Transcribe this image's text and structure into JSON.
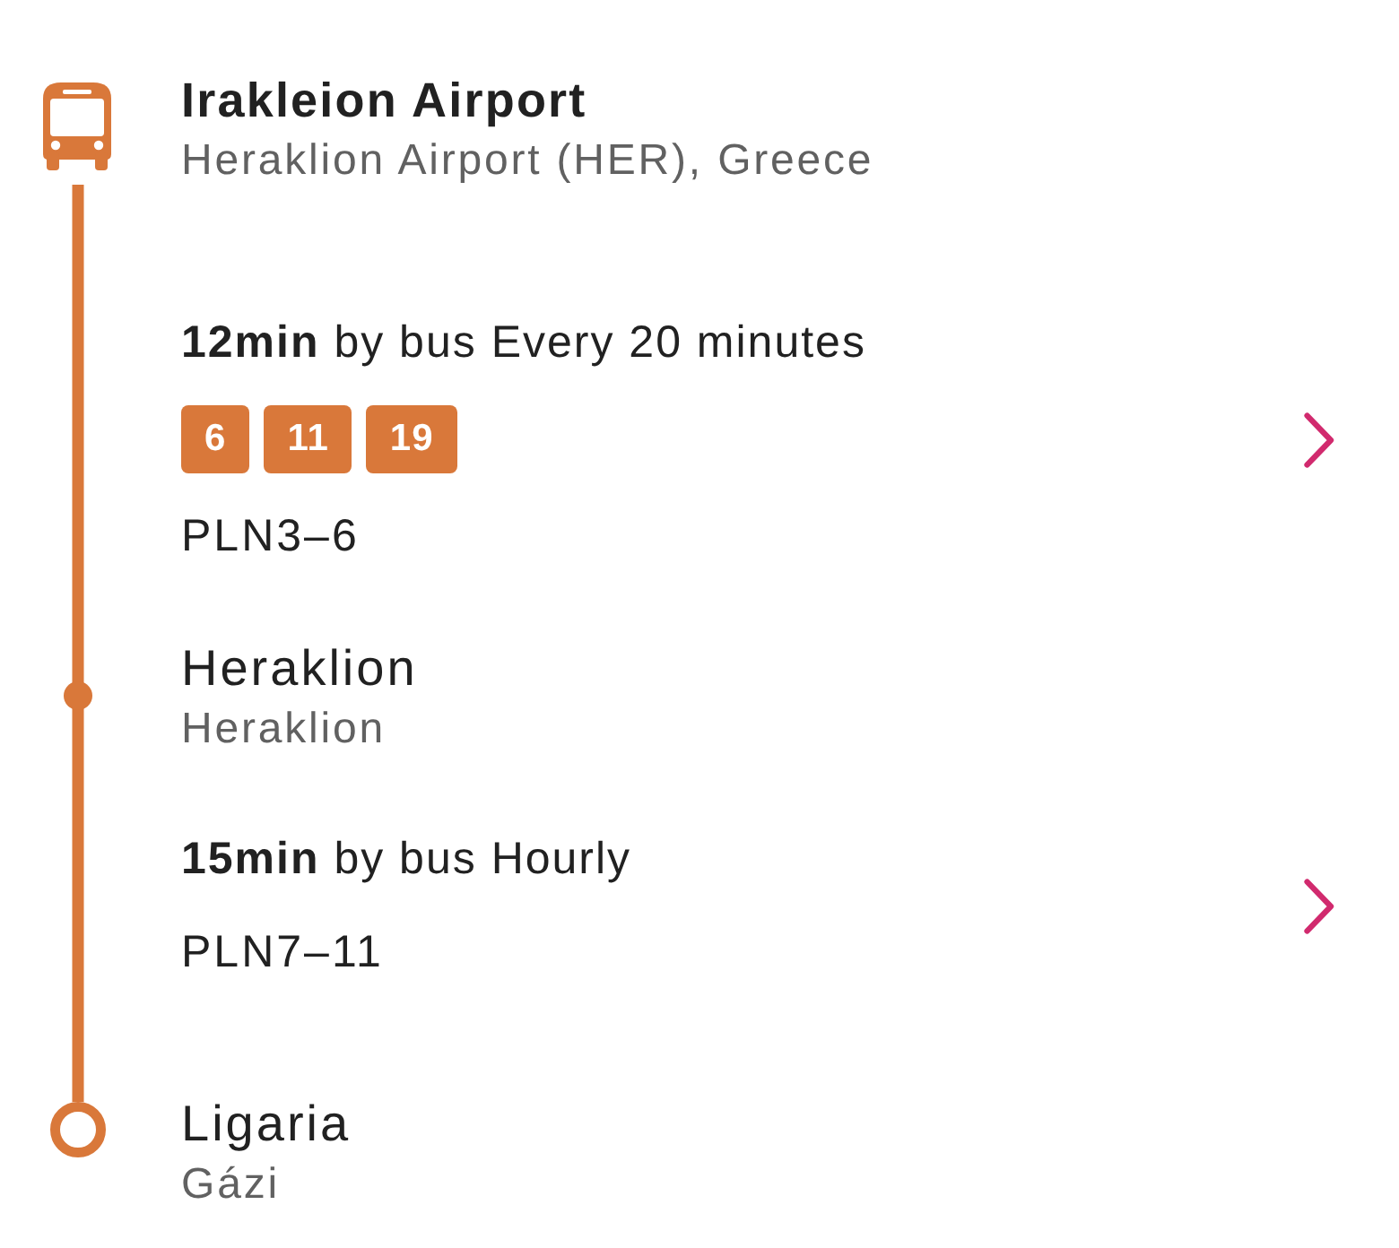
{
  "route": [
    {
      "kind": "origin",
      "emphasized": true,
      "name": "Irakleion Airport",
      "location": "Heraklion Airport (HER), Greece"
    },
    {
      "kind": "leg",
      "summary": "**12min** by bus Every 20 minutes",
      "lines": [
        "6",
        "11",
        "19"
      ],
      "fare": "PLN3–6"
    },
    {
      "kind": "stop",
      "emphasized": false,
      "name": "Heraklion",
      "location": "Heraklion"
    },
    {
      "kind": "leg",
      "summary": "**15min** by bus Hourly",
      "fare": "PLN7–11"
    },
    {
      "kind": "destination",
      "emphasized": false,
      "name": "Ligaria",
      "location": "Gázi"
    }
  ]
}
